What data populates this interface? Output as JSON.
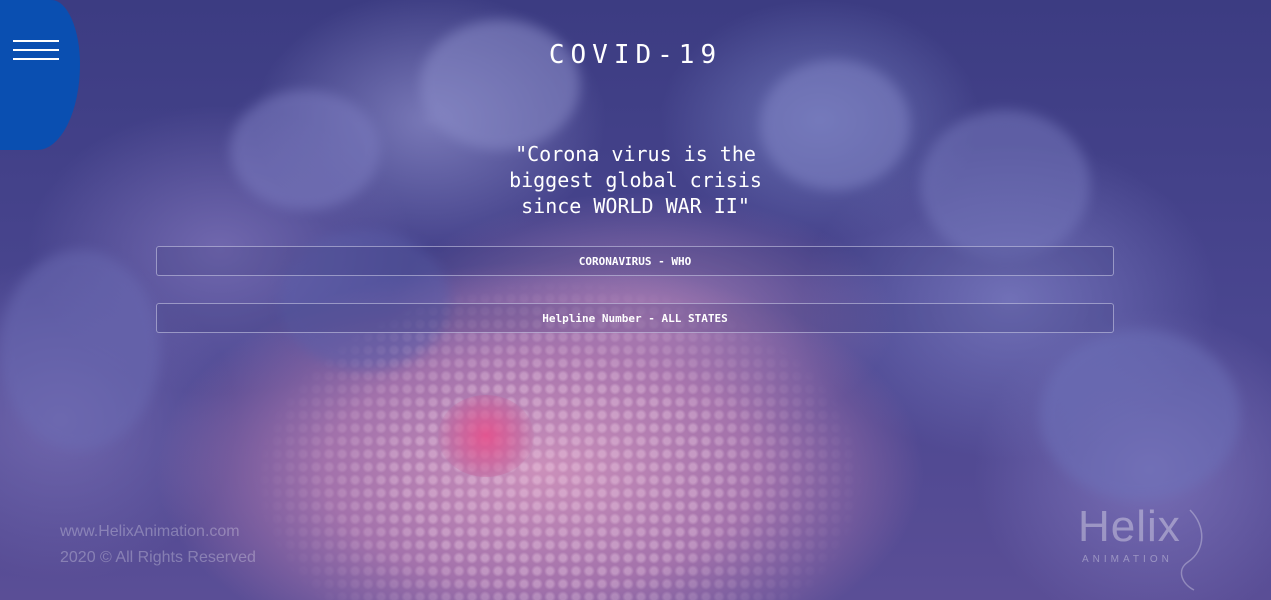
{
  "page": {
    "title": "COVID-19",
    "quote_lines": [
      "\"Corona virus is the",
      "biggest global crisis",
      "since WORLD WAR II\""
    ]
  },
  "links": [
    {
      "label": "CORONAVIRUS - WHO"
    },
    {
      "label": "Helpline Number - ALL STATES"
    }
  ],
  "menu": {
    "icon": "hamburger-menu-icon",
    "color": "#0a4fb1"
  },
  "watermark": {
    "url": "www.HelixAnimation.com",
    "copyright": "2020 © All Rights Reserved",
    "logo_word": "Helix",
    "logo_sub": "ANIMATION"
  },
  "colors": {
    "background": "#3a3a7c",
    "text": "#ffffff"
  }
}
